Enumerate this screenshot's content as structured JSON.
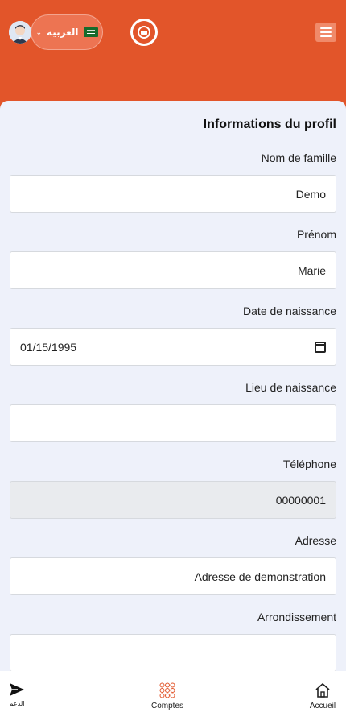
{
  "header": {
    "language": {
      "label": "العربية",
      "flag": "saudi-arabia-flag-icon"
    },
    "accent": "#e2552a"
  },
  "profile": {
    "title": "Informations du profil",
    "fields": [
      {
        "label": "Nom de famille",
        "value": "Demo"
      },
      {
        "label": "Prénom",
        "value": "Marie"
      },
      {
        "label": "Date de naissance",
        "value": "01/15/1995"
      },
      {
        "label": "Lieu de naissance",
        "value": ""
      },
      {
        "label": "Téléphone",
        "value": "00000001",
        "disabled": true
      },
      {
        "label": "Adresse",
        "value": "Adresse de demonstration"
      },
      {
        "label": "Arrondissement",
        "value": ""
      }
    ]
  },
  "bottom_nav": {
    "support": {
      "label": "الدعم",
      "icon": "send-icon"
    },
    "accounts": {
      "label": "Comptes",
      "icon": "grid-icon"
    },
    "home": {
      "label": "Accueil",
      "icon": "home-icon"
    }
  }
}
